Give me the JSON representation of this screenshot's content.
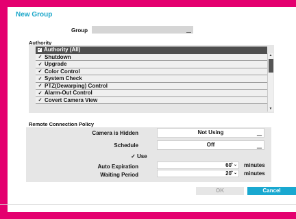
{
  "dialog": {
    "title": "New Group"
  },
  "group": {
    "label": "Group",
    "value": ""
  },
  "authority": {
    "title": "Authority",
    "all_label": "Authority (All)",
    "items": [
      {
        "label": "Shutdown",
        "checked": true
      },
      {
        "label": "Upgrade",
        "checked": true
      },
      {
        "label": "Color Control",
        "checked": true
      },
      {
        "label": "System Check",
        "checked": true
      },
      {
        "label": "PTZ(Dewarping) Control",
        "checked": true
      },
      {
        "label": "Alarm-Out Control",
        "checked": true
      },
      {
        "label": "Covert Camera View",
        "checked": true
      }
    ]
  },
  "remote": {
    "title": "Remote Connection Policy",
    "camera_hidden_label": "Camera is Hidden",
    "camera_hidden_value": "Not Using",
    "schedule_label": "Schedule",
    "schedule_value": "Off",
    "use_label": "Use",
    "auto_expiration_label": "Auto Expiration",
    "auto_expiration_value": "60",
    "waiting_period_label": "Waiting Period",
    "waiting_period_value": "20",
    "unit": "minutes"
  },
  "buttons": {
    "ok": "OK",
    "cancel": "Cancel"
  },
  "glyphs": {
    "check": "✓",
    "checked_box": "✓",
    "dropdown": "⎽",
    "spinner": "⌃⌄",
    "scroll_up": "▲",
    "scroll_down": "▼"
  },
  "colors": {
    "frame": "#e4006f",
    "accent": "#19a8d0",
    "title": "#1aa6c9"
  }
}
